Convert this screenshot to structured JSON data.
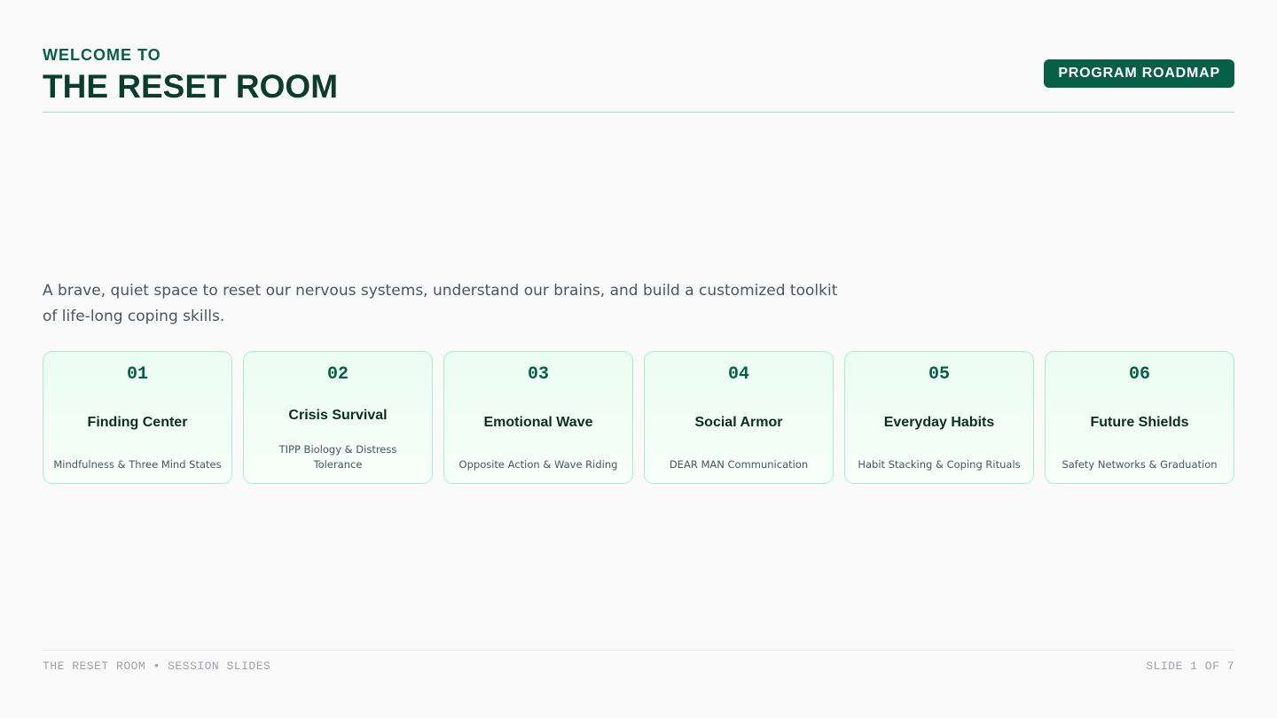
{
  "header": {
    "eyebrow": "WELCOME TO",
    "title": "THE RESET ROOM",
    "badge": "PROGRAM ROADMAP"
  },
  "intro": "A brave, quiet space to reset our nervous systems, understand our brains, and build a customized toolkit of life-long coping skills.",
  "modules": [
    {
      "number": "01",
      "title": "Finding Center",
      "subtitle": "Mindfulness & Three Mind States"
    },
    {
      "number": "02",
      "title": "Crisis Survival",
      "subtitle": "TIPP Biology & Distress Tolerance"
    },
    {
      "number": "03",
      "title": "Emotional Wave",
      "subtitle": "Opposite Action & Wave Riding"
    },
    {
      "number": "04",
      "title": "Social Armor",
      "subtitle": "DEAR MAN Communication"
    },
    {
      "number": "05",
      "title": "Everyday Habits",
      "subtitle": "Habit Stacking & Coping Rituals"
    },
    {
      "number": "06",
      "title": "Future Shields",
      "subtitle": "Safety Networks & Graduation"
    }
  ],
  "footer": {
    "left": "THE RESET ROOM • SESSION SLIDES",
    "right": "SLIDE 1 OF 7"
  },
  "colors": {
    "accent": "#065f46",
    "card_border": "#a7f0c9",
    "background": "#fafafa"
  }
}
